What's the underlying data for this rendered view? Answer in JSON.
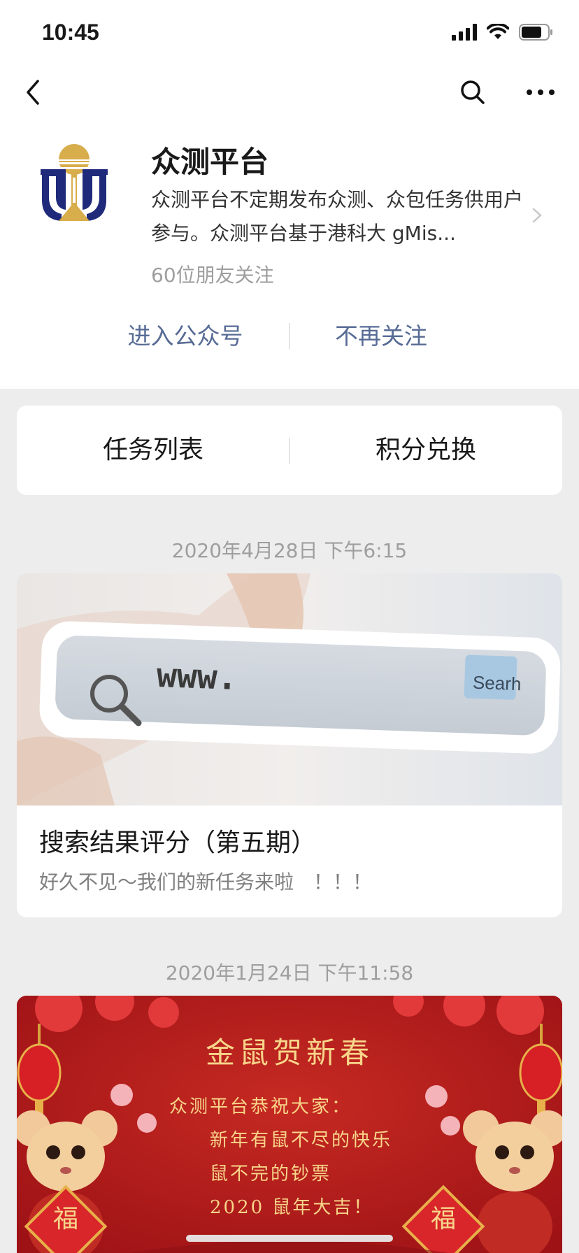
{
  "status_bar": {
    "time": "10:45"
  },
  "nav": {
    "back_icon": "chevron-left-icon",
    "search_icon": "search-icon",
    "more_icon": "more-dots-icon"
  },
  "profile": {
    "name": "众测平台",
    "description": "众测平台不定期发布众测、众包任务供用户参与。众测平台基于港科大 gMis...",
    "followers": "60位朋友关注"
  },
  "actions": {
    "enter": "进入公众号",
    "unfollow": "不再关注"
  },
  "menu": {
    "tasks": "任务列表",
    "points": "积分兑换"
  },
  "articles": [
    {
      "date": "2020年4月28日 下午6:15",
      "cover_text": "www.",
      "cover_button": "Searh",
      "title": "搜索结果评分（第五期）",
      "digest": "好久不见～我们的新任务来啦　！！！"
    },
    {
      "date": "2020年1月24日 下午11:58",
      "cover_title": "金鼠贺新春",
      "cover_lines": [
        "众测平台恭祝大家：",
        "新年有鼠不尽的快乐",
        "鼠不完的钞票",
        "2020 鼠年大吉！"
      ],
      "badge_left": "福",
      "badge_right": "福"
    }
  ],
  "colors": {
    "link": "#576b95",
    "page_bg": "#ededed",
    "festive_red": "#b3191c",
    "gold": "#f7d58a"
  }
}
